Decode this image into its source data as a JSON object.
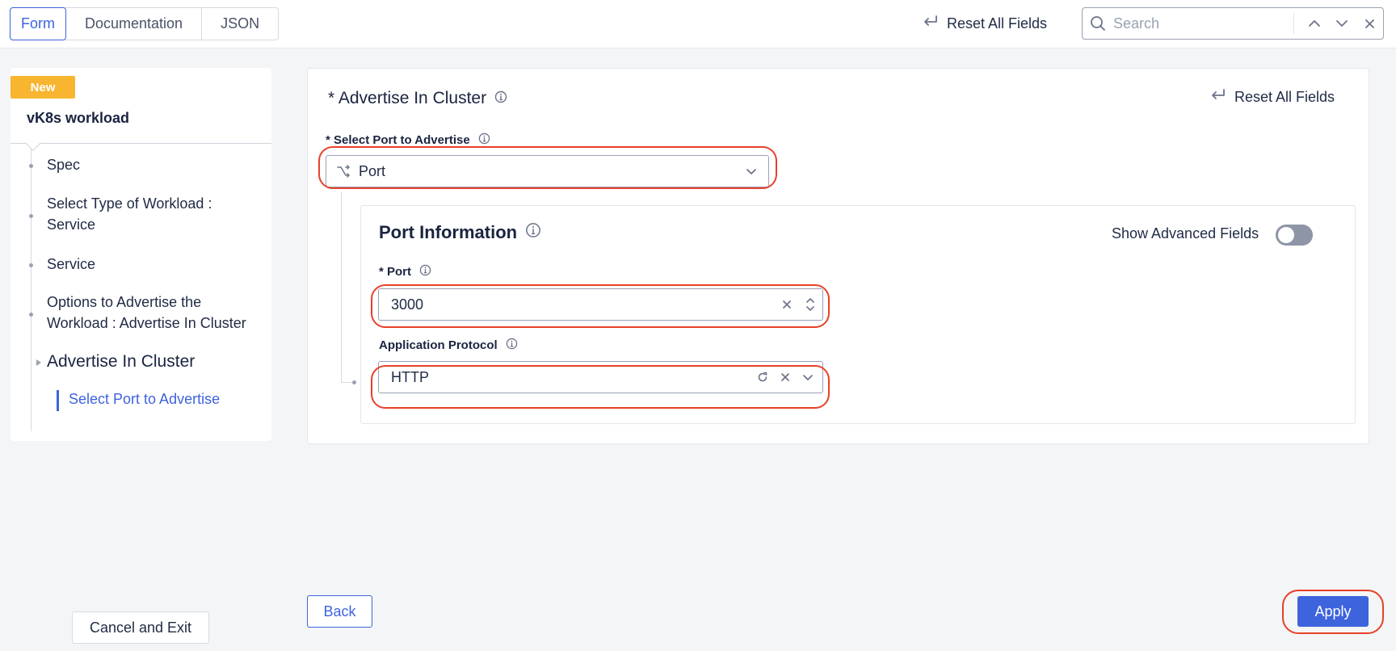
{
  "top_tabs": [
    {
      "label": "Form",
      "active": true
    },
    {
      "label": "Documentation",
      "active": false
    },
    {
      "label": "JSON",
      "active": false
    }
  ],
  "top_reset_label": "Reset All Fields",
  "search": {
    "placeholder": "Search",
    "value": ""
  },
  "sidebar": {
    "badge": "New",
    "title": "vK8s workload",
    "items": [
      {
        "label": "Spec"
      },
      {
        "label": "Select Type of Workload : Service"
      },
      {
        "label": "Service"
      },
      {
        "label": "Options to Advertise the Workload : Advertise In Cluster"
      }
    ],
    "current": "Advertise In Cluster",
    "sub_item": "Select Port to Advertise"
  },
  "cancel_label": "Cancel and Exit",
  "section": {
    "title": "* Advertise In Cluster",
    "reset_label": "Reset All Fields",
    "select_port_label": "* Select Port to Advertise",
    "select_port_value": "Port"
  },
  "port_info": {
    "title": "Port Information",
    "advanced_label": "Show Advanced Fields",
    "advanced_enabled": false,
    "port_label": "* Port",
    "port_value": "3000",
    "protocol_label": "Application Protocol",
    "protocol_value": "HTTP"
  },
  "buttons": {
    "back": "Back",
    "apply": "Apply"
  },
  "colors": {
    "accent": "#3d63dd",
    "badge": "#f7b530",
    "highlight": "#e8402a"
  }
}
